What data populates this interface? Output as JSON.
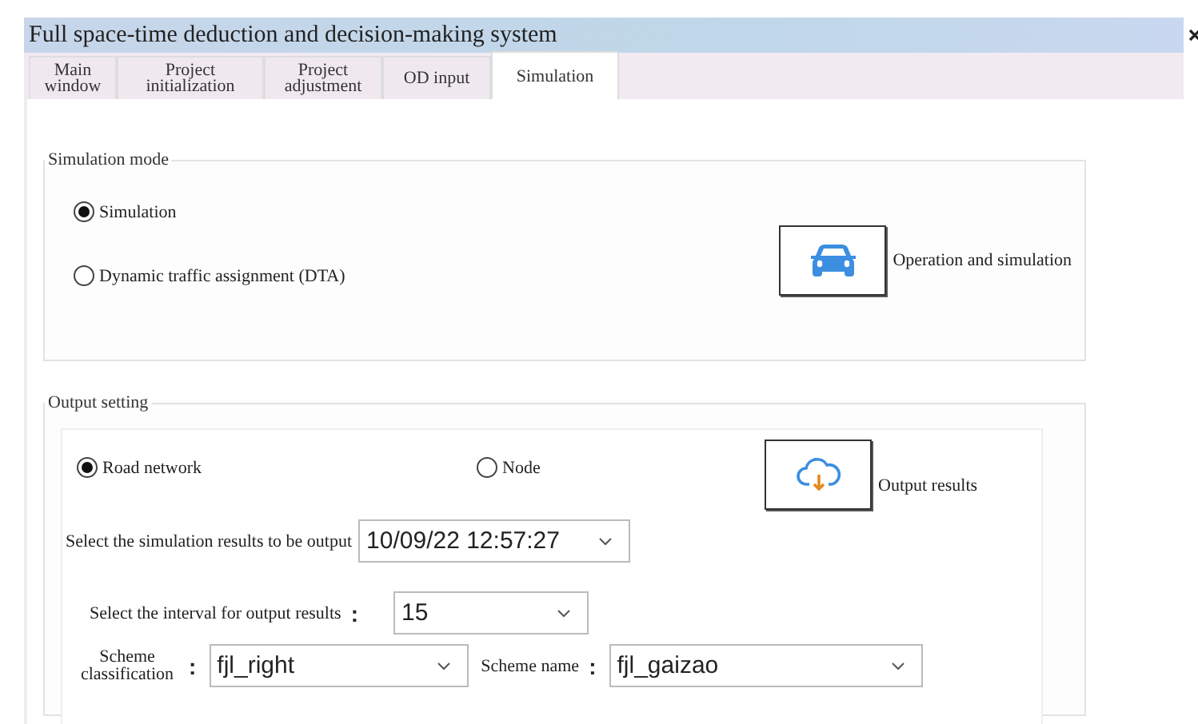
{
  "window": {
    "title": "Full space-time deduction and decision-making system"
  },
  "tabs": [
    {
      "label": "Main window",
      "selected": false
    },
    {
      "label": "Project initialization",
      "selected": false
    },
    {
      "label": "Project adjustment",
      "selected": false
    },
    {
      "label": "OD input",
      "selected": false
    },
    {
      "label": "Simulation",
      "selected": true
    }
  ],
  "simulation_mode": {
    "title": "Simulation mode",
    "options": [
      {
        "label": "Simulation",
        "selected": true
      },
      {
        "label": "Dynamic traffic assignment (DTA)",
        "selected": false
      }
    ],
    "button_label": "Operation and simulation"
  },
  "output_setting": {
    "title": "Output setting",
    "options": [
      {
        "label": "Road network",
        "selected": true
      },
      {
        "label": "Node",
        "selected": false
      }
    ],
    "button_label": "Output results",
    "results_label": "Select the simulation results to be output",
    "results_value": "10/09/22 12:57:27",
    "interval_label": "Select the interval for output results",
    "interval_colon": ":",
    "interval_value": "15",
    "classification_label": "Scheme classification",
    "classification_colon": ":",
    "classification_value": "fjl_right",
    "scheme_name_label": "Scheme name",
    "scheme_name_colon": ":",
    "scheme_name_value": "fjl_gaizao"
  }
}
